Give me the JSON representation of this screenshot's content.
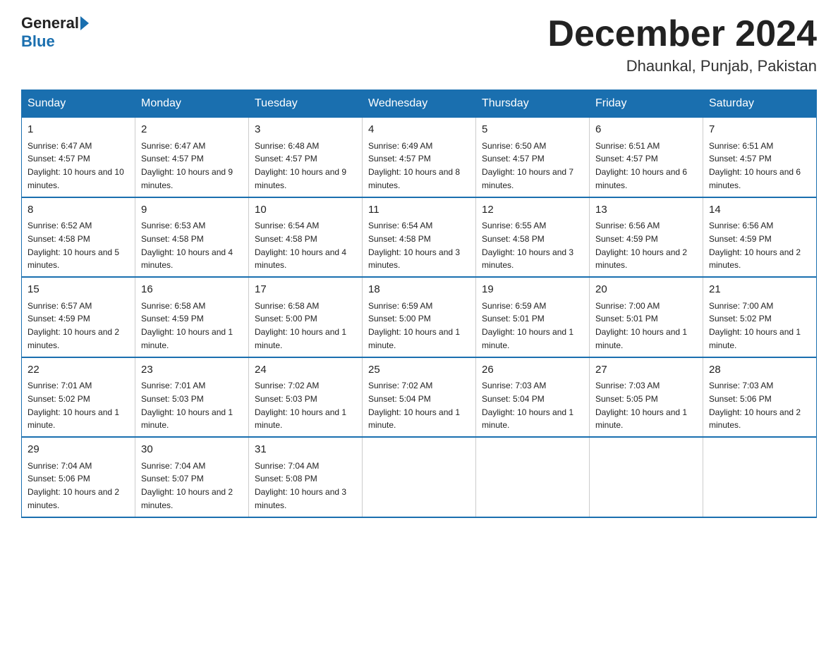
{
  "header": {
    "logo_general": "General",
    "logo_blue": "Blue",
    "month_title": "December 2024",
    "location": "Dhaunkal, Punjab, Pakistan"
  },
  "weekdays": [
    "Sunday",
    "Monday",
    "Tuesday",
    "Wednesday",
    "Thursday",
    "Friday",
    "Saturday"
  ],
  "weeks": [
    [
      {
        "day": "1",
        "sunrise": "6:47 AM",
        "sunset": "4:57 PM",
        "daylight": "10 hours and 10 minutes."
      },
      {
        "day": "2",
        "sunrise": "6:47 AM",
        "sunset": "4:57 PM",
        "daylight": "10 hours and 9 minutes."
      },
      {
        "day": "3",
        "sunrise": "6:48 AM",
        "sunset": "4:57 PM",
        "daylight": "10 hours and 9 minutes."
      },
      {
        "day": "4",
        "sunrise": "6:49 AM",
        "sunset": "4:57 PM",
        "daylight": "10 hours and 8 minutes."
      },
      {
        "day": "5",
        "sunrise": "6:50 AM",
        "sunset": "4:57 PM",
        "daylight": "10 hours and 7 minutes."
      },
      {
        "day": "6",
        "sunrise": "6:51 AM",
        "sunset": "4:57 PM",
        "daylight": "10 hours and 6 minutes."
      },
      {
        "day": "7",
        "sunrise": "6:51 AM",
        "sunset": "4:57 PM",
        "daylight": "10 hours and 6 minutes."
      }
    ],
    [
      {
        "day": "8",
        "sunrise": "6:52 AM",
        "sunset": "4:58 PM",
        "daylight": "10 hours and 5 minutes."
      },
      {
        "day": "9",
        "sunrise": "6:53 AM",
        "sunset": "4:58 PM",
        "daylight": "10 hours and 4 minutes."
      },
      {
        "day": "10",
        "sunrise": "6:54 AM",
        "sunset": "4:58 PM",
        "daylight": "10 hours and 4 minutes."
      },
      {
        "day": "11",
        "sunrise": "6:54 AM",
        "sunset": "4:58 PM",
        "daylight": "10 hours and 3 minutes."
      },
      {
        "day": "12",
        "sunrise": "6:55 AM",
        "sunset": "4:58 PM",
        "daylight": "10 hours and 3 minutes."
      },
      {
        "day": "13",
        "sunrise": "6:56 AM",
        "sunset": "4:59 PM",
        "daylight": "10 hours and 2 minutes."
      },
      {
        "day": "14",
        "sunrise": "6:56 AM",
        "sunset": "4:59 PM",
        "daylight": "10 hours and 2 minutes."
      }
    ],
    [
      {
        "day": "15",
        "sunrise": "6:57 AM",
        "sunset": "4:59 PM",
        "daylight": "10 hours and 2 minutes."
      },
      {
        "day": "16",
        "sunrise": "6:58 AM",
        "sunset": "4:59 PM",
        "daylight": "10 hours and 1 minute."
      },
      {
        "day": "17",
        "sunrise": "6:58 AM",
        "sunset": "5:00 PM",
        "daylight": "10 hours and 1 minute."
      },
      {
        "day": "18",
        "sunrise": "6:59 AM",
        "sunset": "5:00 PM",
        "daylight": "10 hours and 1 minute."
      },
      {
        "day": "19",
        "sunrise": "6:59 AM",
        "sunset": "5:01 PM",
        "daylight": "10 hours and 1 minute."
      },
      {
        "day": "20",
        "sunrise": "7:00 AM",
        "sunset": "5:01 PM",
        "daylight": "10 hours and 1 minute."
      },
      {
        "day": "21",
        "sunrise": "7:00 AM",
        "sunset": "5:02 PM",
        "daylight": "10 hours and 1 minute."
      }
    ],
    [
      {
        "day": "22",
        "sunrise": "7:01 AM",
        "sunset": "5:02 PM",
        "daylight": "10 hours and 1 minute."
      },
      {
        "day": "23",
        "sunrise": "7:01 AM",
        "sunset": "5:03 PM",
        "daylight": "10 hours and 1 minute."
      },
      {
        "day": "24",
        "sunrise": "7:02 AM",
        "sunset": "5:03 PM",
        "daylight": "10 hours and 1 minute."
      },
      {
        "day": "25",
        "sunrise": "7:02 AM",
        "sunset": "5:04 PM",
        "daylight": "10 hours and 1 minute."
      },
      {
        "day": "26",
        "sunrise": "7:03 AM",
        "sunset": "5:04 PM",
        "daylight": "10 hours and 1 minute."
      },
      {
        "day": "27",
        "sunrise": "7:03 AM",
        "sunset": "5:05 PM",
        "daylight": "10 hours and 1 minute."
      },
      {
        "day": "28",
        "sunrise": "7:03 AM",
        "sunset": "5:06 PM",
        "daylight": "10 hours and 2 minutes."
      }
    ],
    [
      {
        "day": "29",
        "sunrise": "7:04 AM",
        "sunset": "5:06 PM",
        "daylight": "10 hours and 2 minutes."
      },
      {
        "day": "30",
        "sunrise": "7:04 AM",
        "sunset": "5:07 PM",
        "daylight": "10 hours and 2 minutes."
      },
      {
        "day": "31",
        "sunrise": "7:04 AM",
        "sunset": "5:08 PM",
        "daylight": "10 hours and 3 minutes."
      },
      null,
      null,
      null,
      null
    ]
  ]
}
